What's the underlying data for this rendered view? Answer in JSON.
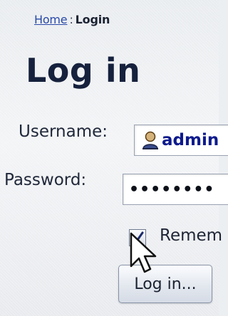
{
  "breadcrumb": {
    "home_link": "Home",
    "separator": ":",
    "current": "Login"
  },
  "page": {
    "title": "Log in"
  },
  "form": {
    "username_label": "Username:",
    "username_value": "admin",
    "password_label": "Password:",
    "password_value": "••••••••",
    "remember_label": "Remem",
    "remember_checked": true,
    "submit_label": "Log in..."
  },
  "icons": {
    "username_field_icon": "user-icon",
    "checkbox_mark": "check-icon",
    "pointer": "arrow-cursor-icon"
  },
  "colors": {
    "link": "#2949a8",
    "title": "#16213d",
    "input_text": "#0d1a8c"
  }
}
